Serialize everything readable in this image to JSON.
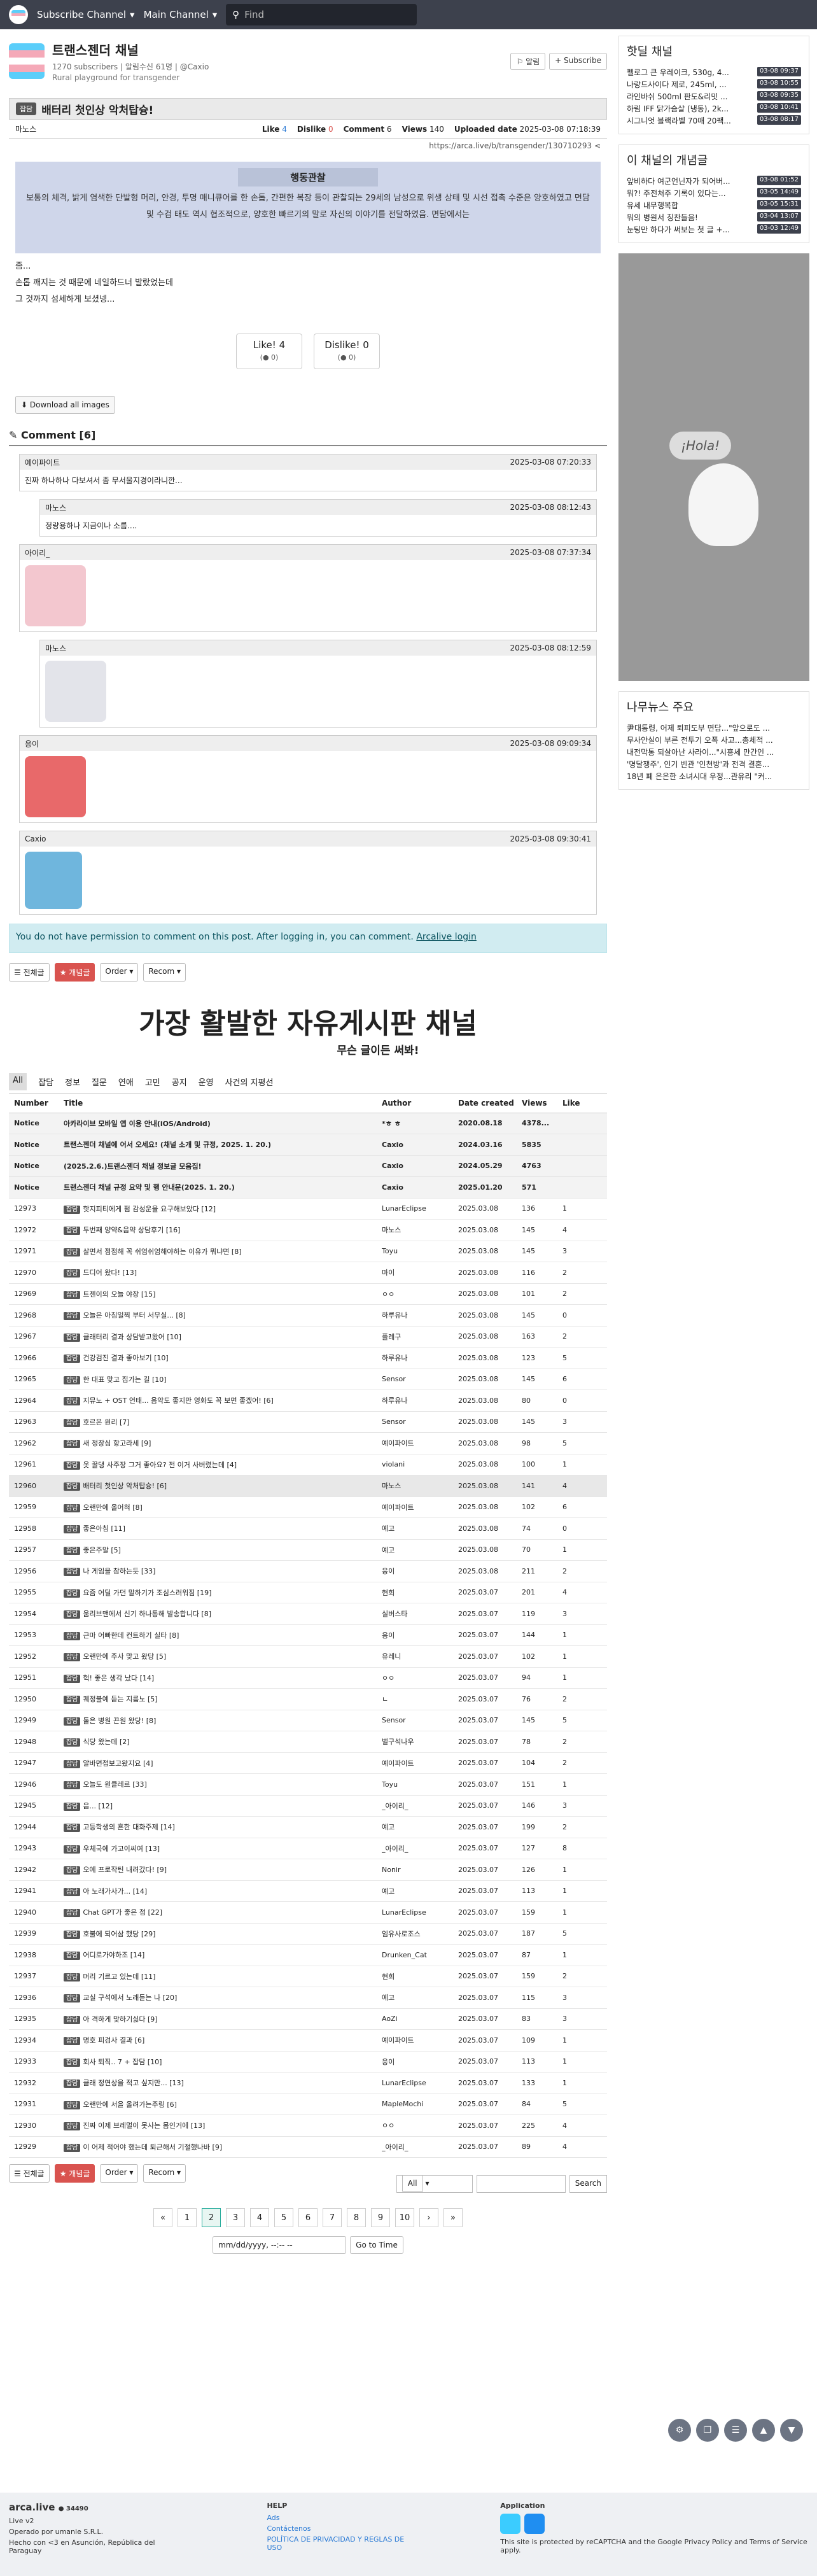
{
  "topbar": {
    "subscribe": "Subscribe Channel",
    "main": "Main Channel",
    "search_placeholder": "Find"
  },
  "channel": {
    "title": "트랜스젠더 채널",
    "subs": "1270 subscribers",
    "noti": "알림수신 61명",
    "owner": "@Caxio",
    "desc": "Rural playground for transgender",
    "alarm": "알림",
    "subscribe": "Subscribe"
  },
  "post": {
    "category": "잡담",
    "title": "배터리 첫인상 악처탑슝!",
    "author": "마노스",
    "like_l": "Like",
    "like": "4",
    "dislike_l": "Dislike",
    "dislike": "0",
    "comment_l": "Comment",
    "comment": "6",
    "views_l": "Views",
    "views": "140",
    "uploaded_l": "Uploaded date",
    "uploaded": "2025-03-08 07:18:39",
    "url": "https://arca.live/b/transgender/130710293",
    "img_heading": "행동관찰",
    "img_text": "보통의 체격, 밝게 염색한 단발형 머리, 안경, 투명 매니큐어를 한 손톱, 간편한 복장 등이 관찰되는 29세의 남성으로 위생 상태 및 시선 접촉 수준은 양호하였고 면담 및 수검 태도 역시 협조적으로, 양호한 빠르기의 말로 자신의 이야기를 전달하였음. 면담에서는",
    "body": [
      "좀...",
      "손톱 깨지는 것 때문에 네일하드너 발랐었는데",
      "그 것까지 섬세하게 보셨넹..."
    ],
    "like_btn": "Like!",
    "like_count": "4",
    "like_sub": "(● 0)",
    "dislike_btn": "Dislike!",
    "dislike_count": "0",
    "dislike_sub": "(● 0)",
    "download": "Download all images"
  },
  "comments_h": "Comment [6]",
  "comments": [
    {
      "user": "예이파이트",
      "time": "2025-03-08 07:20:33",
      "text": "진짜 하나하나 다보셔서 좀 무서울지경이라니깐..."
    },
    {
      "user": "마노스",
      "time": "2025-03-08 08:12:43",
      "text": "정량용하나 지금이나 소름...."
    },
    {
      "user": "아이리_",
      "time": "2025-03-08 07:37:34",
      "text": ""
    },
    {
      "user": "마노스",
      "time": "2025-03-08 08:12:59",
      "text": ""
    },
    {
      "user": "응이",
      "time": "2025-03-08 09:09:34",
      "text": ""
    },
    {
      "user": "Caxio",
      "time": "2025-03-08 09:30:41",
      "text": ""
    }
  ],
  "perm": {
    "text": "You do not have permission to comment on this post. After logging in, you can comment.",
    "login": "Arcalive login"
  },
  "ctrls": {
    "all": "전체글",
    "best": "개념글",
    "order": "Order",
    "recom": "Recom"
  },
  "banner": {
    "big": "가장 활발한 자유게시판 채널",
    "small": "무슨 글이든 써봐!"
  },
  "tabs": [
    "All",
    "잡담",
    "정보",
    "질문",
    "연애",
    "고민",
    "공지",
    "운영",
    "사건의 지평선"
  ],
  "table": {
    "headers": [
      "Number",
      "Title",
      "Author",
      "Date created",
      "Views",
      "Like"
    ],
    "notices": [
      [
        "Notice",
        "아카라이브 모바일 앱 이용 안내(iOS/Android)",
        "*ㅎ ㅎ",
        "2020.08.18",
        "4378...",
        ""
      ],
      [
        "Notice",
        "트랜스젠더 채널에 어서 오세요! (채널 소개 및 규정, 2025. 1. 20.)",
        "Caxio",
        "2024.03.16",
        "5835",
        ""
      ],
      [
        "Notice",
        "(2025.2.6.)트랜스젠더 채널 정보글 모음집!",
        "Caxio",
        "2024.05.29",
        "4763",
        ""
      ],
      [
        "Notice",
        "트랜스젠더 채널 규정 요약 및 행 안내문(2025. 1. 20.)",
        "Caxio",
        "2025.01.20",
        "571",
        ""
      ]
    ],
    "rows": [
      [
        "12973",
        "잡담",
        "핫지피티에게 펌 감성운을 요구해보았다 [12]",
        "LunarEclipse",
        "2025.03.08",
        "136",
        "1"
      ],
      [
        "12972",
        "잡담",
        "두번째 양약&음약 상담후기 [16]",
        "마노스",
        "2025.03.08",
        "145",
        "4"
      ],
      [
        "12971",
        "잡담",
        "살면서 점점해 꼭 쉬엄쉬엄해야하는 이유가 뭐냐면 [8]",
        "Toyu",
        "2025.03.08",
        "145",
        "3"
      ],
      [
        "12970",
        "잡담",
        "드디어 왔다! [13]",
        "마이",
        "2025.03.08",
        "116",
        "2"
      ],
      [
        "12969",
        "잡담",
        "트젠이의 오늘 야장 [15]",
        "ㅇㅇ",
        "2025.03.08",
        "101",
        "2"
      ],
      [
        "12968",
        "잡담",
        "오늘은 아침일찍 부터 서무실... [8]",
        "하루유나",
        "2025.03.08",
        "145",
        "0"
      ],
      [
        "12967",
        "잡담",
        "클래터리 결과 상담받고왔어 [10]",
        "플레구",
        "2025.03.08",
        "163",
        "2"
      ],
      [
        "12966",
        "잡담",
        "건강검진 결과 좋아보기 [10]",
        "하루유나",
        "2025.03.08",
        "123",
        "5"
      ],
      [
        "12965",
        "잡담",
        "한 대표 맞고 집가는 길 [10]",
        "Sensor",
        "2025.03.08",
        "145",
        "6"
      ],
      [
        "12964",
        "잡담",
        "지뮤노 + OST 언태... 음악도 좋지만 영화도 꼭 보면 좋겠어! [6]",
        "하루유나",
        "2025.03.08",
        "80",
        "0"
      ],
      [
        "12963",
        "잡담",
        "호르몬 원리 [7]",
        "Sensor",
        "2025.03.08",
        "145",
        "3"
      ],
      [
        "12962",
        "잡담",
        "새 정장심 항고라세 [9]",
        "예이파이트",
        "2025.03.08",
        "98",
        "5"
      ],
      [
        "12961",
        "잡담",
        "옷 꿀댕 사주장 그거 좋아요? 전 이거 사버렸는데 [4]",
        "violani",
        "2025.03.08",
        "100",
        "1"
      ],
      [
        "12960",
        "잡담",
        "배터리 첫인상 악처탑슝! [6]",
        "마노스",
        "2025.03.08",
        "141",
        "4"
      ],
      [
        "12959",
        "잡담",
        "오랜만에 올어혀 [8]",
        "예이파이트",
        "2025.03.08",
        "102",
        "6"
      ],
      [
        "12958",
        "잡담",
        "좋은아침 [11]",
        "예고",
        "2025.03.08",
        "74",
        "0"
      ],
      [
        "12957",
        "잡담",
        "좋은주말 [5]",
        "예고",
        "2025.03.08",
        "70",
        "1"
      ],
      [
        "12956",
        "잡담",
        "나 게임을 참하는듯 [33]",
        "응이",
        "2025.03.08",
        "211",
        "2"
      ],
      [
        "12955",
        "잡담",
        "요즘 어딜 가던 말하기가 조심스러워짐 [19]",
        "현희",
        "2025.03.07",
        "201",
        "4"
      ],
      [
        "12954",
        "잡담",
        "움리브맨에서 신기 하나통해 발송합니다 [8]",
        "실버스타",
        "2025.03.07",
        "119",
        "3"
      ],
      [
        "12953",
        "잡담",
        "근마 어빠한데 컨트하기 실타 [8]",
        "응이",
        "2025.03.07",
        "144",
        "1"
      ],
      [
        "12952",
        "잡담",
        "오랜만에 주사 맞고 왔당 [5]",
        "유레니",
        "2025.03.07",
        "102",
        "1"
      ],
      [
        "12951",
        "잡담",
        "헉! 좋은 생각 났다 [14]",
        "ㅇㅇ",
        "2025.03.07",
        "94",
        "1"
      ],
      [
        "12950",
        "잡담",
        "퀘정불예 듣는 지름노 [5]",
        "ㄴ",
        "2025.03.07",
        "76",
        "2"
      ],
      [
        "12949",
        "잡담",
        "둘은 병원 끈원 왔당! [8]",
        "Sensor",
        "2025.03.07",
        "145",
        "5"
      ],
      [
        "12948",
        "잡담",
        "식당 왔는데 [2]",
        "벌구석나우",
        "2025.03.07",
        "78",
        "2"
      ],
      [
        "12947",
        "잡담",
        "알바면접보고왔지요 [4]",
        "예이파이트",
        "2025.03.07",
        "104",
        "2"
      ],
      [
        "12946",
        "잡담",
        "오늘도 원클레르 [33]",
        "Toyu",
        "2025.03.07",
        "151",
        "1"
      ],
      [
        "12945",
        "잡담",
        "음... [12]",
        "_아이리_",
        "2025.03.07",
        "146",
        "3"
      ],
      [
        "12944",
        "잡담",
        "고등학생의 흔한 대화주제 [14]",
        "예고",
        "2025.03.07",
        "199",
        "2"
      ],
      [
        "12943",
        "잡담",
        "우체국에 가고이씨여 [13]",
        "_아이리_",
        "2025.03.07",
        "127",
        "8"
      ],
      [
        "12942",
        "잡담",
        "오예 프로작틴 내려갔다! [9]",
        "Nonir",
        "2025.03.07",
        "126",
        "1"
      ],
      [
        "12941",
        "잡담",
        "아 노래가사가... [14]",
        "예고",
        "2025.03.07",
        "113",
        "1"
      ],
      [
        "12940",
        "잡담",
        "Chat GPT가 좋은 점 [22]",
        "LunarEclipse",
        "2025.03.07",
        "159",
        "1"
      ],
      [
        "12939",
        "잡담",
        "호불에 되어삼 했당 [29]",
        "임유사로조스",
        "2025.03.07",
        "187",
        "5"
      ],
      [
        "12938",
        "잡담",
        "어디로가야하조 [14]",
        "Drunken_Cat",
        "2025.03.07",
        "87",
        "1"
      ],
      [
        "12937",
        "잡담",
        "머리 기르고 있는데 [11]",
        "현희",
        "2025.03.07",
        "159",
        "2"
      ],
      [
        "12936",
        "잡담",
        "교실 구석에서 노래듣는 나 [20]",
        "예고",
        "2025.03.07",
        "115",
        "3"
      ],
      [
        "12935",
        "잡담",
        "아 격하게 맞하기싫다 [9]",
        "AoZi",
        "2025.03.07",
        "83",
        "3"
      ],
      [
        "12934",
        "잡담",
        "명호 피검사 결과 [6]",
        "예이파이트",
        "2025.03.07",
        "109",
        "1"
      ],
      [
        "12933",
        "잡담",
        "회사 퇴직.. 7 + 잡담 [10]",
        "응이",
        "2025.03.07",
        "113",
        "1"
      ],
      [
        "12932",
        "잡담",
        "클래 정연상을 적고 싶지만... [13]",
        "LunarEclipse",
        "2025.03.07",
        "133",
        "1"
      ],
      [
        "12931",
        "잡담",
        "오랜만에 서을 올려가는주링 [6]",
        "MapleMochi",
        "2025.03.07",
        "84",
        "5"
      ],
      [
        "12930",
        "잡담",
        "진짜 이제 브레멀이 못사는 몸인거에 [13]",
        "ㅇㅇ",
        "2025.03.07",
        "225",
        "4"
      ],
      [
        "12929",
        "잡담",
        "이 어제 적어야 했는데 퇴근해서 기절했나바 [9]",
        "_아이리_",
        "2025.03.07",
        "89",
        "4"
      ]
    ]
  },
  "pager": [
    "1",
    "2",
    "3",
    "4",
    "5",
    "6",
    "7",
    "8",
    "9",
    "10"
  ],
  "search": {
    "select": "All",
    "btn": "Search"
  },
  "datejump": {
    "placeholder": "mm/dd/yyyy, --:-- --",
    "btn": "Go to Time"
  },
  "side": {
    "hot_h": "핫딜 채널",
    "hot": [
      [
        "펠로그 큰 우레이크, 530g, 4...",
        "03-08 09:37"
      ],
      [
        "나랑드사이다 제로, 245ml, ...",
        "03-08 10:55"
      ],
      [
        "라인바쉬 500ml 판도&리밋 ...",
        "03-08 09:35"
      ],
      [
        "하림 IFF 닭가슴살 (냉동), 2k...",
        "03-08 10:41"
      ],
      [
        "시그니엇 블랙라벨 70매 20팩...",
        "03-08 08:17"
      ]
    ],
    "best_h": "이 채널의 개념글",
    "best": [
      [
        "앞비하다 여군언닌자가 되어버...",
        "03-08 01:52"
      ],
      [
        "뭐?! 주전처주 기록이 있다는...",
        "03-05 14:49"
      ],
      [
        "유세 내무행복합",
        "03-05 15:31"
      ],
      [
        "뭐의 병원서 칭찬들음!",
        "03-04 13:07"
      ],
      [
        "눈팅만 하다가 써보는 첫 글 +...",
        "03-03 12:49"
      ]
    ],
    "ad_text": "¡Hola!",
    "news_h": "나무뉴스 주요",
    "news": [
      "尹대통령, 어제 퇴피도부 면담...\"앞으로도 ...",
      "무사안실이 부른 전투기 오폭 사고...총체적 ...",
      "내전막통 되살아난 사라이...\"시흥세 만간인 ...",
      "'명달쟁주', 인기 빈관 '인천방'과 전격 결혼...",
      "18년 폐 은은한 소녀시대 우정...관유리 \"커..."
    ]
  },
  "footer": {
    "brand": "arca.live",
    "count": "34490",
    "ver": "Live v2",
    "op": "Operado por umanle S.R.L.",
    "made": "Hecho con <3 en Asunción, República del Paraguay",
    "help": "HELP",
    "ads": "Ads",
    "contact": "Contáctenos",
    "policy": "POLÍTICA DE PRIVACIDAD Y REGLAS DE USO",
    "app": "Application",
    "recaptcha": "This site is protected by reCAPTCHA and the Google Privacy Policy and Terms of Service apply."
  }
}
